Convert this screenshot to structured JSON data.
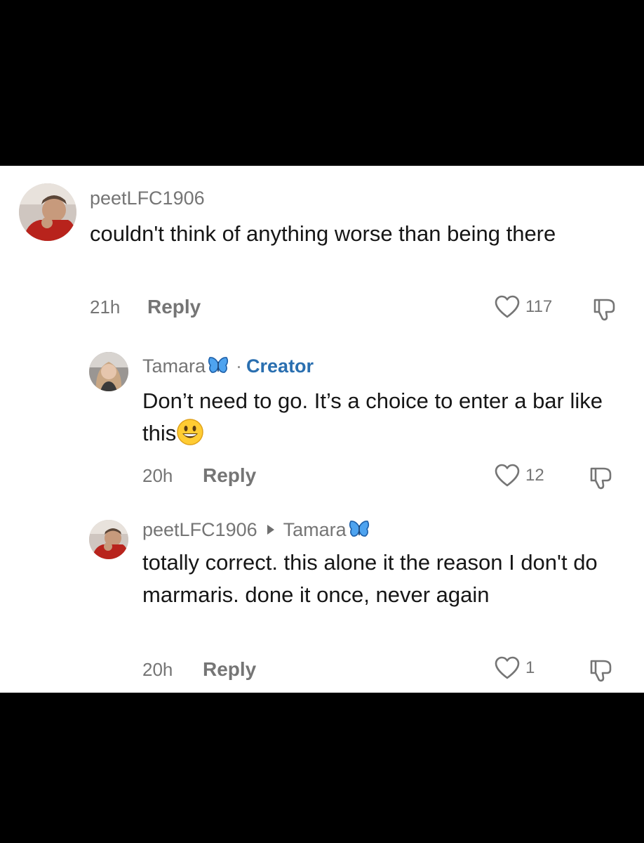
{
  "comments": [
    {
      "username": "peetLFC1906",
      "text": "couldn't think of anything worse than being there",
      "time": "21h",
      "reply_label": "Reply",
      "likes": "117"
    },
    {
      "username": "Tamara",
      "creator_label": "Creator",
      "text": "Don’t need to go. It’s a choice to enter a bar like this",
      "time": "20h",
      "reply_label": "Reply",
      "likes": "12"
    },
    {
      "username": "peetLFC1906",
      "reply_to": "Tamara",
      "text": "totally correct. this alone it the reason I don't do marmaris. done it once, never again",
      "time": "20h",
      "reply_label": "Reply",
      "likes": "1"
    }
  ],
  "icons": {
    "like": "heart-outline-icon",
    "dislike": "thumbs-down-outline-icon",
    "badge": "blue-butterfly-emoji",
    "smiley": "smiling-face-emoji"
  },
  "colors": {
    "background": "#000000",
    "panel": "#ffffff",
    "creator": "#2a6fb0",
    "butterfly": "#3d8fe0"
  }
}
